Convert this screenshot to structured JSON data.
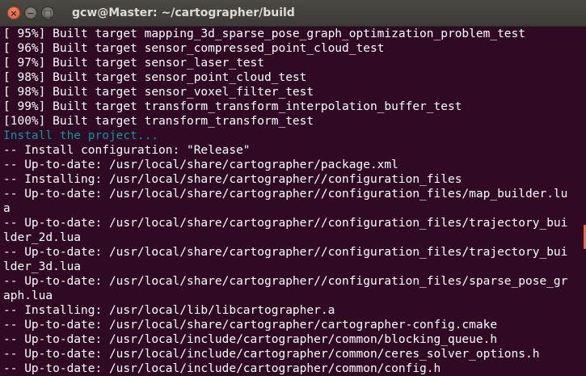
{
  "window": {
    "title": "gcw@Master: ~/cartographer/build",
    "close_glyph": "×",
    "min_glyph": "−",
    "max_glyph": "□"
  },
  "terminal": {
    "lines": [
      {
        "text": "[ 95%] Built target mapping_3d_sparse_pose_graph_optimization_problem_test",
        "color": "white"
      },
      {
        "text": "[ 96%] Built target sensor_compressed_point_cloud_test",
        "color": "white"
      },
      {
        "text": "[ 97%] Built target sensor_laser_test",
        "color": "white"
      },
      {
        "text": "[ 98%] Built target sensor_point_cloud_test",
        "color": "white"
      },
      {
        "text": "[ 98%] Built target sensor_voxel_filter_test",
        "color": "white"
      },
      {
        "text": "[ 99%] Built target transform_transform_interpolation_buffer_test",
        "color": "white"
      },
      {
        "text": "[100%] Built target transform_transform_test",
        "color": "white"
      },
      {
        "text": "Install the project...",
        "color": "cyan"
      },
      {
        "text": "-- Install configuration: \"Release\"",
        "color": "white"
      },
      {
        "text": "-- Up-to-date: /usr/local/share/cartographer/package.xml",
        "color": "white"
      },
      {
        "text": "-- Installing: /usr/local/share/cartographer//configuration_files",
        "color": "white"
      },
      {
        "text": "-- Up-to-date: /usr/local/share/cartographer//configuration_files/map_builder.lu",
        "color": "white"
      },
      {
        "text": "a",
        "color": "white"
      },
      {
        "text": "-- Up-to-date: /usr/local/share/cartographer//configuration_files/trajectory_bui",
        "color": "white"
      },
      {
        "text": "lder_2d.lua",
        "color": "white"
      },
      {
        "text": "-- Up-to-date: /usr/local/share/cartographer//configuration_files/trajectory_bui",
        "color": "white"
      },
      {
        "text": "lder_3d.lua",
        "color": "white"
      },
      {
        "text": "-- Up-to-date: /usr/local/share/cartographer//configuration_files/sparse_pose_gr",
        "color": "white"
      },
      {
        "text": "aph.lua",
        "color": "white"
      },
      {
        "text": "-- Installing: /usr/local/lib/libcartographer.a",
        "color": "white"
      },
      {
        "text": "-- Up-to-date: /usr/local/share/cartographer/cartographer-config.cmake",
        "color": "white"
      },
      {
        "text": "-- Up-to-date: /usr/local/include/cartographer/common/blocking_queue.h",
        "color": "white"
      },
      {
        "text": "-- Up-to-date: /usr/local/include/cartographer/common/ceres_solver_options.h",
        "color": "white"
      },
      {
        "text": "-- Up-to-date: /usr/local/include/cartographer/common/config.h",
        "color": "white"
      }
    ]
  },
  "colors": {
    "background": "#300a24",
    "text": "#ffffff",
    "cyan": "#06989a",
    "title_text": "#dfdbd2",
    "close_button": "#e05a2b"
  }
}
